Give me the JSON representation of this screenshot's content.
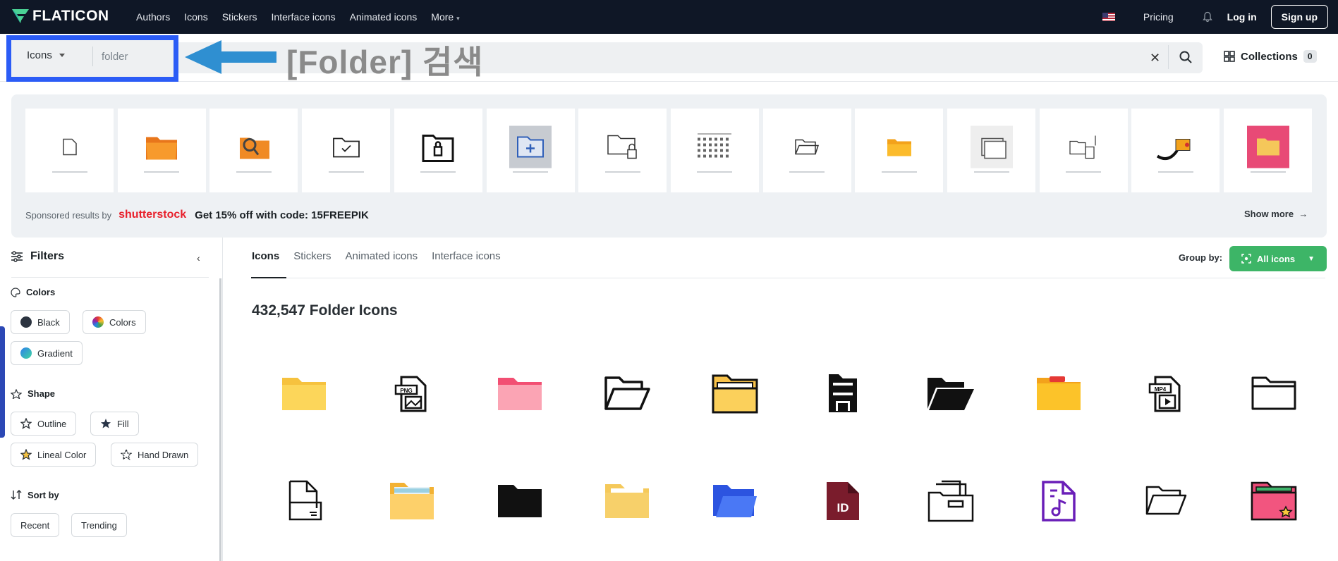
{
  "nav": {
    "brand": "FLATICON",
    "links": [
      "Authors",
      "Icons",
      "Stickers",
      "Interface icons",
      "Animated icons",
      "More"
    ],
    "pricing": "Pricing",
    "login": "Log in",
    "signup": "Sign up"
  },
  "search": {
    "type_label": "Icons",
    "query": "folder",
    "annotation": "[Folder] 검색",
    "collections_label": "Collections",
    "collections_count": "0"
  },
  "sponsored": {
    "label": "Sponsored results by",
    "brand": "shutterstock",
    "promo": "Get 15% off with code: 15FREEPIK",
    "show_more": "Show more"
  },
  "sidebar": {
    "title": "Filters",
    "colors_heading": "Colors",
    "colors": [
      "Black",
      "Colors",
      "Gradient"
    ],
    "shape_heading": "Shape",
    "shapes": [
      "Outline",
      "Fill",
      "Lineal Color",
      "Hand Drawn"
    ],
    "sort_heading": "Sort by",
    "sorts": [
      "Recent",
      "Trending"
    ]
  },
  "main": {
    "tabs": [
      "Icons",
      "Stickers",
      "Animated icons",
      "Interface icons"
    ],
    "group_by_label": "Group by:",
    "group_by_value": "All icons",
    "results_title": "432,547 Folder Icons"
  },
  "colors": {
    "nav_bg": "#0f1726",
    "highlight": "#2b5cf6",
    "arrow": "#2f8fd1",
    "accent_green": "#3db567",
    "shutterstock_red": "#e8212c"
  }
}
